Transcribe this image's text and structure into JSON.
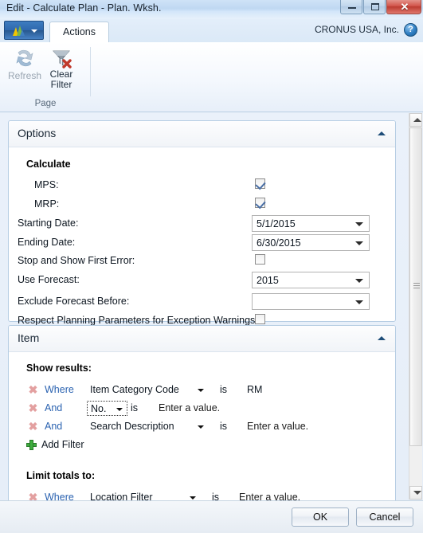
{
  "window": {
    "title": "Edit - Calculate Plan - Plan. Wksh.",
    "minimize_label": "",
    "maximize_label": "",
    "close_label": "✕"
  },
  "ribbon": {
    "nav_button": "nav-menu",
    "tab_label": "Actions",
    "company": "CRONUS USA, Inc.",
    "help_label": "?",
    "group_label": "Page",
    "buttons": [
      {
        "label": "Refresh",
        "icon": "refresh-icon",
        "disabled": true
      },
      {
        "label": "Clear\nFilter",
        "line1": "Clear",
        "line2": "Filter",
        "icon": "clear-filter-icon",
        "disabled": false
      }
    ]
  },
  "options_panel": {
    "title": "Options",
    "group_heading": "Calculate",
    "fields": [
      {
        "label": "MPS:",
        "type": "checkbox",
        "checked": true
      },
      {
        "label": "MRP:",
        "type": "checkbox",
        "checked": true
      },
      {
        "label": "Starting Date:",
        "type": "combo",
        "value": "5/1/2015"
      },
      {
        "label": "Ending Date:",
        "type": "combo",
        "value": "6/30/2015"
      },
      {
        "label": "Stop and Show First Error:",
        "type": "checkbox",
        "checked": false
      },
      {
        "label": "Use Forecast:",
        "type": "combo",
        "value": "2015"
      },
      {
        "label": "Exclude Forecast Before:",
        "type": "combo",
        "value": ""
      },
      {
        "label": "Respect Planning Parameters for Exception Warnings:",
        "type": "checkbox",
        "checked": false
      }
    ]
  },
  "item_panel": {
    "title": "Item",
    "show_results_heading": "Show results:",
    "limit_totals_heading": "Limit totals to:",
    "add_filter_label": "Add Filter",
    "show_results_filters": [
      {
        "conjunction": "Where",
        "field": "Item Category Code",
        "operator": "is",
        "value": "RM",
        "focused": false
      },
      {
        "conjunction": "And",
        "field": "No.",
        "operator": "is",
        "value": "Enter a value.",
        "focused": true
      },
      {
        "conjunction": "And",
        "field": "Search Description",
        "operator": "is",
        "value": "Enter a value.",
        "focused": false
      }
    ],
    "limit_totals_filters": [
      {
        "conjunction": "Where",
        "field": "Location Filter",
        "operator": "is",
        "value": "Enter a value.",
        "focused": false
      }
    ]
  },
  "footer": {
    "ok_label": "OK",
    "cancel_label": "Cancel"
  },
  "colors": {
    "accent": "#2a62b0",
    "close_red": "#c8453a",
    "plus_green": "#3fae3f",
    "delete_pink": "#e3a0a0"
  }
}
